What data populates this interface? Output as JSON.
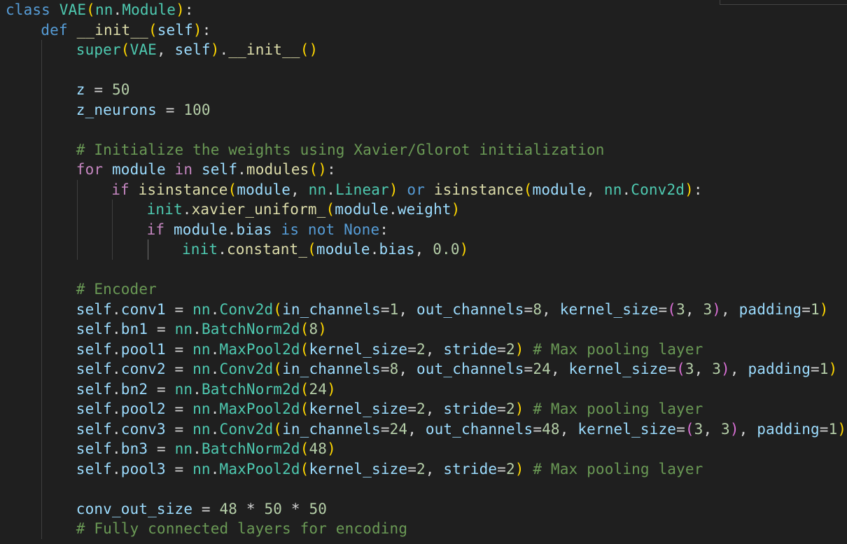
{
  "editor": {
    "language": "python",
    "lines": [
      {
        "indent": 0,
        "guides": [],
        "tokens": [
          [
            "class ",
            "kw"
          ],
          [
            "VAE",
            "cls"
          ],
          [
            "(",
            "p1"
          ],
          [
            "nn",
            "cls"
          ],
          [
            ".",
            "txt"
          ],
          [
            "Module",
            "cls"
          ],
          [
            ")",
            "p1"
          ],
          [
            ":",
            "txt"
          ]
        ]
      },
      {
        "indent": 1,
        "guides": [],
        "tokens": [
          [
            "def ",
            "kw"
          ],
          [
            "__init__",
            "fn"
          ],
          [
            "(",
            "p1"
          ],
          [
            "self",
            "var"
          ],
          [
            ")",
            "p1"
          ],
          [
            ":",
            "txt"
          ]
        ]
      },
      {
        "indent": 2,
        "guides": [
          1
        ],
        "tokens": [
          [
            "super",
            "cls"
          ],
          [
            "(",
            "p1"
          ],
          [
            "VAE",
            "cls"
          ],
          [
            ", ",
            "txt"
          ],
          [
            "self",
            "var"
          ],
          [
            ")",
            "p1"
          ],
          [
            ".",
            "txt"
          ],
          [
            "__init__",
            "fn"
          ],
          [
            "(",
            "p1"
          ],
          [
            ")",
            "p1"
          ]
        ]
      },
      {
        "indent": 0,
        "guides": [
          1
        ],
        "tokens": []
      },
      {
        "indent": 2,
        "guides": [
          1
        ],
        "tokens": [
          [
            "z",
            "var"
          ],
          [
            " = ",
            "txt"
          ],
          [
            "50",
            "num"
          ]
        ]
      },
      {
        "indent": 2,
        "guides": [
          1
        ],
        "tokens": [
          [
            "z_neurons",
            "var"
          ],
          [
            " = ",
            "txt"
          ],
          [
            "100",
            "num"
          ]
        ]
      },
      {
        "indent": 0,
        "guides": [
          1
        ],
        "tokens": []
      },
      {
        "indent": 2,
        "guides": [
          1
        ],
        "tokens": [
          [
            "# Initialize the weights using Xavier/Glorot initialization",
            "cmt"
          ]
        ]
      },
      {
        "indent": 2,
        "guides": [
          1
        ],
        "tokens": [
          [
            "for ",
            "ctl"
          ],
          [
            "module",
            "var"
          ],
          [
            " in ",
            "ctl"
          ],
          [
            "self",
            "var"
          ],
          [
            ".",
            "txt"
          ],
          [
            "modules",
            "fn"
          ],
          [
            "(",
            "p1"
          ],
          [
            ")",
            "p1"
          ],
          [
            ":",
            "txt"
          ]
        ]
      },
      {
        "indent": 3,
        "guides": [
          1,
          2
        ],
        "tokens": [
          [
            "if ",
            "ctl"
          ],
          [
            "isinstance",
            "fn"
          ],
          [
            "(",
            "p1"
          ],
          [
            "module",
            "var"
          ],
          [
            ", ",
            "txt"
          ],
          [
            "nn",
            "cls"
          ],
          [
            ".",
            "txt"
          ],
          [
            "Linear",
            "cls"
          ],
          [
            ")",
            "p1"
          ],
          [
            " or ",
            "kw"
          ],
          [
            "isinstance",
            "fn"
          ],
          [
            "(",
            "p1"
          ],
          [
            "module",
            "var"
          ],
          [
            ", ",
            "txt"
          ],
          [
            "nn",
            "cls"
          ],
          [
            ".",
            "txt"
          ],
          [
            "Conv2d",
            "cls"
          ],
          [
            ")",
            "p1"
          ],
          [
            ":",
            "txt"
          ]
        ]
      },
      {
        "indent": 4,
        "guides": [
          1,
          2,
          3
        ],
        "tokens": [
          [
            "init",
            "cls"
          ],
          [
            ".",
            "txt"
          ],
          [
            "xavier_uniform_",
            "fn"
          ],
          [
            "(",
            "p1"
          ],
          [
            "module",
            "var"
          ],
          [
            ".",
            "txt"
          ],
          [
            "weight",
            "var"
          ],
          [
            ")",
            "p1"
          ]
        ]
      },
      {
        "indent": 4,
        "guides": [
          1,
          2,
          3
        ],
        "tokens": [
          [
            "if ",
            "ctl"
          ],
          [
            "module",
            "var"
          ],
          [
            ".",
            "txt"
          ],
          [
            "bias",
            "var"
          ],
          [
            " is not ",
            "kw"
          ],
          [
            "None",
            "kw"
          ],
          [
            ":",
            "txt"
          ]
        ]
      },
      {
        "indent": 5,
        "guides": [
          1,
          2,
          3,
          4
        ],
        "active": 4,
        "tokens": [
          [
            "init",
            "cls"
          ],
          [
            ".",
            "txt"
          ],
          [
            "constant_",
            "fn"
          ],
          [
            "(",
            "p1"
          ],
          [
            "module",
            "var"
          ],
          [
            ".",
            "txt"
          ],
          [
            "bias",
            "var"
          ],
          [
            ", ",
            "txt"
          ],
          [
            "0.0",
            "num"
          ],
          [
            ")",
            "p1"
          ]
        ]
      },
      {
        "indent": 0,
        "guides": [
          1
        ],
        "tokens": []
      },
      {
        "indent": 2,
        "guides": [
          1
        ],
        "tokens": [
          [
            "# Encoder",
            "cmt"
          ]
        ]
      },
      {
        "indent": 2,
        "guides": [
          1
        ],
        "tokens": [
          [
            "self",
            "var"
          ],
          [
            ".",
            "txt"
          ],
          [
            "conv1",
            "var"
          ],
          [
            " = ",
            "txt"
          ],
          [
            "nn",
            "cls"
          ],
          [
            ".",
            "txt"
          ],
          [
            "Conv2d",
            "cls"
          ],
          [
            "(",
            "p1"
          ],
          [
            "in_channels",
            "var"
          ],
          [
            "=",
            "txt"
          ],
          [
            "1",
            "num"
          ],
          [
            ", ",
            "txt"
          ],
          [
            "out_channels",
            "var"
          ],
          [
            "=",
            "txt"
          ],
          [
            "8",
            "num"
          ],
          [
            ", ",
            "txt"
          ],
          [
            "kernel_size",
            "var"
          ],
          [
            "=",
            "txt"
          ],
          [
            "(",
            "p2"
          ],
          [
            "3",
            "num"
          ],
          [
            ", ",
            "txt"
          ],
          [
            "3",
            "num"
          ],
          [
            ")",
            "p2"
          ],
          [
            ", ",
            "txt"
          ],
          [
            "padding",
            "var"
          ],
          [
            "=",
            "txt"
          ],
          [
            "1",
            "num"
          ],
          [
            ")",
            "p1"
          ]
        ]
      },
      {
        "indent": 2,
        "guides": [
          1
        ],
        "tokens": [
          [
            "self",
            "var"
          ],
          [
            ".",
            "txt"
          ],
          [
            "bn1",
            "var"
          ],
          [
            " = ",
            "txt"
          ],
          [
            "nn",
            "cls"
          ],
          [
            ".",
            "txt"
          ],
          [
            "BatchNorm2d",
            "cls"
          ],
          [
            "(",
            "p1"
          ],
          [
            "8",
            "num"
          ],
          [
            ")",
            "p1"
          ]
        ]
      },
      {
        "indent": 2,
        "guides": [
          1
        ],
        "tokens": [
          [
            "self",
            "var"
          ],
          [
            ".",
            "txt"
          ],
          [
            "pool1",
            "var"
          ],
          [
            " = ",
            "txt"
          ],
          [
            "nn",
            "cls"
          ],
          [
            ".",
            "txt"
          ],
          [
            "MaxPool2d",
            "cls"
          ],
          [
            "(",
            "p1"
          ],
          [
            "kernel_size",
            "var"
          ],
          [
            "=",
            "txt"
          ],
          [
            "2",
            "num"
          ],
          [
            ", ",
            "txt"
          ],
          [
            "stride",
            "var"
          ],
          [
            "=",
            "txt"
          ],
          [
            "2",
            "num"
          ],
          [
            ")",
            "p1"
          ],
          [
            " ",
            "txt"
          ],
          [
            "# Max pooling layer",
            "cmt"
          ]
        ]
      },
      {
        "indent": 2,
        "guides": [
          1
        ],
        "tokens": [
          [
            "self",
            "var"
          ],
          [
            ".",
            "txt"
          ],
          [
            "conv2",
            "var"
          ],
          [
            " = ",
            "txt"
          ],
          [
            "nn",
            "cls"
          ],
          [
            ".",
            "txt"
          ],
          [
            "Conv2d",
            "cls"
          ],
          [
            "(",
            "p1"
          ],
          [
            "in_channels",
            "var"
          ],
          [
            "=",
            "txt"
          ],
          [
            "8",
            "num"
          ],
          [
            ", ",
            "txt"
          ],
          [
            "out_channels",
            "var"
          ],
          [
            "=",
            "txt"
          ],
          [
            "24",
            "num"
          ],
          [
            ", ",
            "txt"
          ],
          [
            "kernel_size",
            "var"
          ],
          [
            "=",
            "txt"
          ],
          [
            "(",
            "p2"
          ],
          [
            "3",
            "num"
          ],
          [
            ", ",
            "txt"
          ],
          [
            "3",
            "num"
          ],
          [
            ")",
            "p2"
          ],
          [
            ", ",
            "txt"
          ],
          [
            "padding",
            "var"
          ],
          [
            "=",
            "txt"
          ],
          [
            "1",
            "num"
          ],
          [
            ")",
            "p1"
          ]
        ]
      },
      {
        "indent": 2,
        "guides": [
          1
        ],
        "tokens": [
          [
            "self",
            "var"
          ],
          [
            ".",
            "txt"
          ],
          [
            "bn2",
            "var"
          ],
          [
            " = ",
            "txt"
          ],
          [
            "nn",
            "cls"
          ],
          [
            ".",
            "txt"
          ],
          [
            "BatchNorm2d",
            "cls"
          ],
          [
            "(",
            "p1"
          ],
          [
            "24",
            "num"
          ],
          [
            ")",
            "p1"
          ]
        ]
      },
      {
        "indent": 2,
        "guides": [
          1
        ],
        "tokens": [
          [
            "self",
            "var"
          ],
          [
            ".",
            "txt"
          ],
          [
            "pool2",
            "var"
          ],
          [
            " = ",
            "txt"
          ],
          [
            "nn",
            "cls"
          ],
          [
            ".",
            "txt"
          ],
          [
            "MaxPool2d",
            "cls"
          ],
          [
            "(",
            "p1"
          ],
          [
            "kernel_size",
            "var"
          ],
          [
            "=",
            "txt"
          ],
          [
            "2",
            "num"
          ],
          [
            ", ",
            "txt"
          ],
          [
            "stride",
            "var"
          ],
          [
            "=",
            "txt"
          ],
          [
            "2",
            "num"
          ],
          [
            ")",
            "p1"
          ],
          [
            " ",
            "txt"
          ],
          [
            "# Max pooling layer",
            "cmt"
          ]
        ]
      },
      {
        "indent": 2,
        "guides": [
          1
        ],
        "tokens": [
          [
            "self",
            "var"
          ],
          [
            ".",
            "txt"
          ],
          [
            "conv3",
            "var"
          ],
          [
            " = ",
            "txt"
          ],
          [
            "nn",
            "cls"
          ],
          [
            ".",
            "txt"
          ],
          [
            "Conv2d",
            "cls"
          ],
          [
            "(",
            "p1"
          ],
          [
            "in_channels",
            "var"
          ],
          [
            "=",
            "txt"
          ],
          [
            "24",
            "num"
          ],
          [
            ", ",
            "txt"
          ],
          [
            "out_channels",
            "var"
          ],
          [
            "=",
            "txt"
          ],
          [
            "48",
            "num"
          ],
          [
            ", ",
            "txt"
          ],
          [
            "kernel_size",
            "var"
          ],
          [
            "=",
            "txt"
          ],
          [
            "(",
            "p2"
          ],
          [
            "3",
            "num"
          ],
          [
            ", ",
            "txt"
          ],
          [
            "3",
            "num"
          ],
          [
            ")",
            "p2"
          ],
          [
            ", ",
            "txt"
          ],
          [
            "padding",
            "var"
          ],
          [
            "=",
            "txt"
          ],
          [
            "1",
            "num"
          ],
          [
            ")",
            "p1"
          ]
        ]
      },
      {
        "indent": 2,
        "guides": [
          1
        ],
        "tokens": [
          [
            "self",
            "var"
          ],
          [
            ".",
            "txt"
          ],
          [
            "bn3",
            "var"
          ],
          [
            " = ",
            "txt"
          ],
          [
            "nn",
            "cls"
          ],
          [
            ".",
            "txt"
          ],
          [
            "BatchNorm2d",
            "cls"
          ],
          [
            "(",
            "p1"
          ],
          [
            "48",
            "num"
          ],
          [
            ")",
            "p1"
          ]
        ]
      },
      {
        "indent": 2,
        "guides": [
          1
        ],
        "tokens": [
          [
            "self",
            "var"
          ],
          [
            ".",
            "txt"
          ],
          [
            "pool3",
            "var"
          ],
          [
            " = ",
            "txt"
          ],
          [
            "nn",
            "cls"
          ],
          [
            ".",
            "txt"
          ],
          [
            "MaxPool2d",
            "cls"
          ],
          [
            "(",
            "p1"
          ],
          [
            "kernel_size",
            "var"
          ],
          [
            "=",
            "txt"
          ],
          [
            "2",
            "num"
          ],
          [
            ", ",
            "txt"
          ],
          [
            "stride",
            "var"
          ],
          [
            "=",
            "txt"
          ],
          [
            "2",
            "num"
          ],
          [
            ")",
            "p1"
          ],
          [
            " ",
            "txt"
          ],
          [
            "# Max pooling layer",
            "cmt"
          ]
        ]
      },
      {
        "indent": 0,
        "guides": [
          1
        ],
        "tokens": []
      },
      {
        "indent": 2,
        "guides": [
          1
        ],
        "tokens": [
          [
            "conv_out_size",
            "var"
          ],
          [
            " = ",
            "txt"
          ],
          [
            "48",
            "num"
          ],
          [
            " * ",
            "txt"
          ],
          [
            "50",
            "num"
          ],
          [
            " * ",
            "txt"
          ],
          [
            "50",
            "num"
          ]
        ]
      },
      {
        "indent": 2,
        "guides": [
          1
        ],
        "tokens": [
          [
            "# Fully connected layers for encoding",
            "cmt"
          ]
        ]
      }
    ]
  }
}
